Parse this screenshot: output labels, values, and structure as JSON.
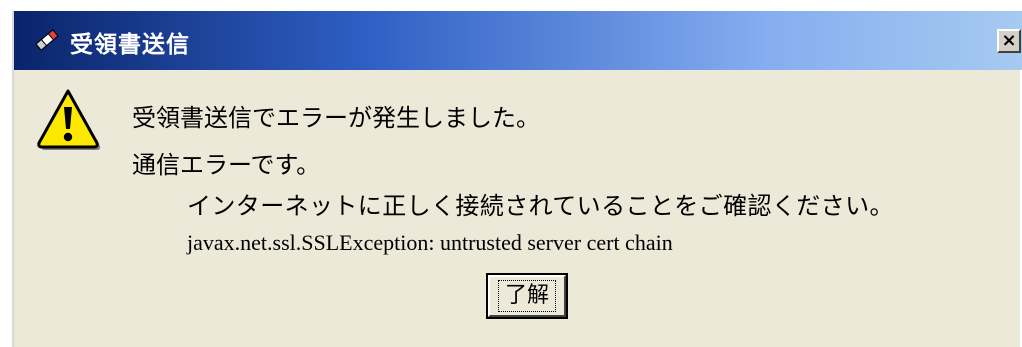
{
  "window": {
    "title": "受領書送信",
    "title_icon": "pencil-eraser-icon",
    "close_glyph": "×"
  },
  "message": {
    "icon": "warning-icon",
    "lines": [
      "受領書送信でエラーが発生しました。",
      "通信エラーです。",
      "インターネットに正しく接続されていることをご確認ください。",
      "javax.net.ssl.SSLException: untrusted server cert chain"
    ]
  },
  "buttons": {
    "ok_label": "了解"
  },
  "colors": {
    "titlebar_start": "#0a246a",
    "titlebar_end": "#a6caf0",
    "dialog_background": "#ece9d8",
    "warning_yellow": "#ffe800"
  }
}
